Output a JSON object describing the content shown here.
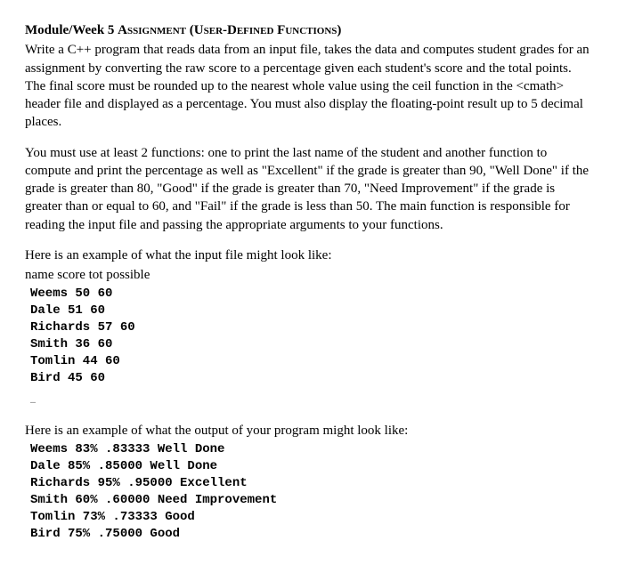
{
  "heading": {
    "prefix": "Module/Week 5 ",
    "word1": "Assignment",
    "paren_open": " (",
    "word2": "User-Defined Functions",
    "paren_close": ")"
  },
  "para1": "Write a C++ program that reads data from an input file, takes the data and computes student grades for an assignment by converting the raw score to  a percentage given each student's score and the total points. The final score must be rounded up to the nearest whole value using the ceil function in the <cmath> header file and displayed as a percentage. You must also display the floating-point result up to 5 decimal places.",
  "para2": "You must use at least 2 functions: one to print the last name of the student and another function to compute and print the percentage as well as \"Excellent\" if the grade is greater than 90, \"Well Done\" if the grade is greater than 80, \"Good\" if the grade is greater than 70, \"Need Improvement\" if the grade is greater than or equal to 60, and \"Fail\" if the grade is less than 50. The main function is responsible for reading the input file and passing the appropriate arguments to your functions.",
  "input_intro": "Here is an example of what the input file might look like:",
  "input_header": "name  score  tot possible",
  "input_lines": "Weems 50 60\nDale 51 60\nRichards 57 60\nSmith 36 60\nTomlin 44 60\nBird 45 60",
  "ellipsis": "…",
  "output_intro": "Here is an example of what the output of your program might look like:",
  "output_lines": "Weems 83% .83333 Well Done\nDale 85% .85000 Well Done\nRichards 95% .95000 Excellent\nSmith 60% .60000 Need Improvement\nTomlin 73% .73333 Good\nBird 75% .75000 Good"
}
